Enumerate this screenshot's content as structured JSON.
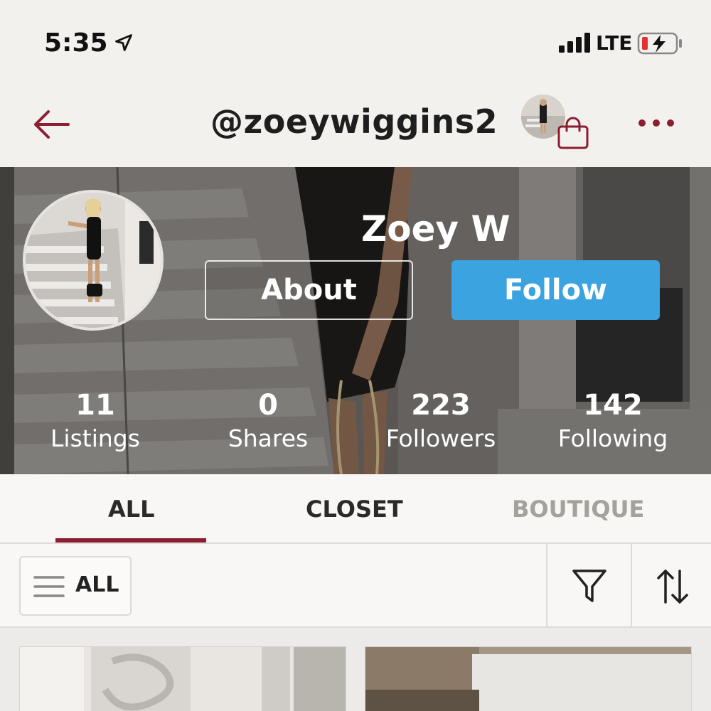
{
  "status_bar": {
    "time": "5:35",
    "network": "LTE",
    "icons": [
      "location-arrow-icon",
      "signal-bars-icon",
      "battery-charging-icon"
    ]
  },
  "header": {
    "username": "@zoeywiggins2",
    "back_icon": "back-arrow-icon",
    "bag_icon": "shopping-bag-icon",
    "more_icon": "more-dots-icon"
  },
  "profile": {
    "display_name": "Zoey W",
    "about_label": "About",
    "follow_label": "Follow",
    "stats": [
      {
        "value": "11",
        "label": "Listings"
      },
      {
        "value": "0",
        "label": "Shares"
      },
      {
        "value": "223",
        "label": "Followers"
      },
      {
        "value": "142",
        "label": "Following"
      }
    ]
  },
  "tabs": [
    {
      "label": "ALL",
      "active": true
    },
    {
      "label": "CLOSET",
      "active": false
    },
    {
      "label": "BOUTIQUE",
      "active": false
    }
  ],
  "filter_bar": {
    "dropdown_label": "ALL",
    "icons": [
      "menu-lines-icon",
      "filter-funnel-icon",
      "sort-arrows-icon"
    ]
  },
  "colors": {
    "accent": "#8b1e2f",
    "follow_button": "#3aa3e0",
    "background": "#f3f1ee",
    "inactive_tab": "#a5a19c"
  }
}
